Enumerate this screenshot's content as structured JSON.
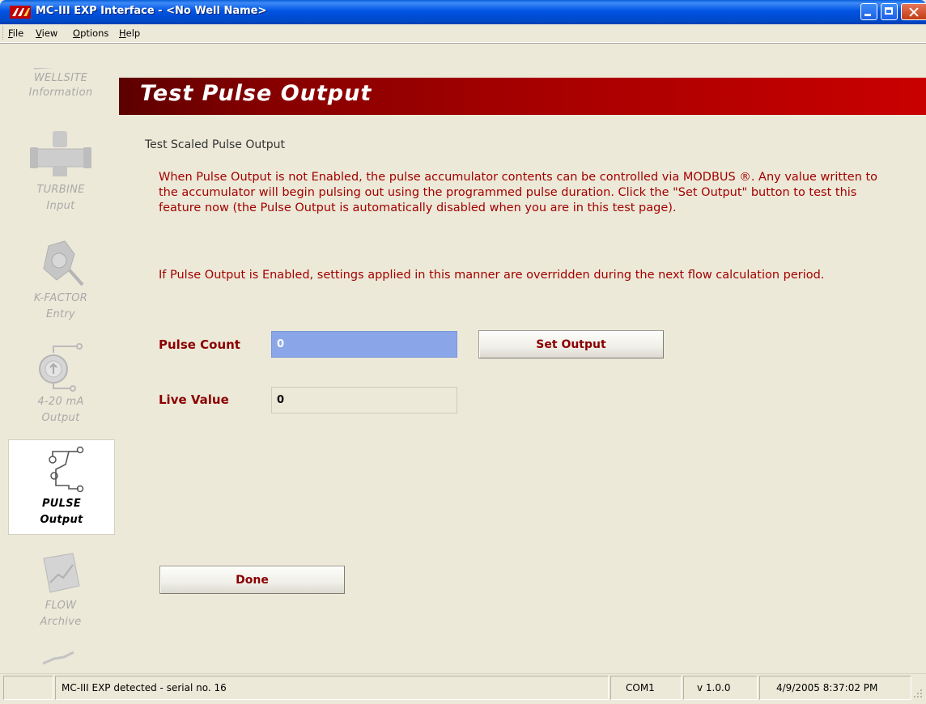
{
  "window": {
    "title": "MC-III EXP Interface - <No Well Name>",
    "titlebar_color": "#0054e3",
    "controls": [
      "minimize-icon",
      "maximize-icon",
      "close-icon"
    ]
  },
  "menu": {
    "items": [
      {
        "label": "File"
      },
      {
        "label": "View"
      },
      {
        "label": "Options"
      },
      {
        "label": "Help"
      }
    ]
  },
  "sidebar": {
    "items": [
      {
        "line1": "WELLSITE",
        "line2": "Information",
        "icon": "wellsite-icon",
        "active": false
      },
      {
        "line1": "TURBINE",
        "line2": "Input",
        "icon": "turbine-icon",
        "active": false
      },
      {
        "line1": "K-FACTOR",
        "line2": "Entry",
        "icon": "k-factor-icon",
        "active": false
      },
      {
        "line1": "4-20 mA",
        "line2": "Output",
        "icon": "gauge-icon",
        "active": false
      },
      {
        "line1": "PULSE",
        "line2": "Output",
        "icon": "pulse-icon",
        "active": true
      },
      {
        "line1": "FLOW",
        "line2": "Archive",
        "icon": "chart-icon",
        "active": false
      }
    ]
  },
  "header": {
    "title": "Test Pulse Output",
    "banner_color": "#a50000"
  },
  "main": {
    "section_title": "Test Scaled Pulse Output",
    "paragraph1": "When Pulse Output is not Enabled, the pulse accumulator contents can be controlled via MODBUS ®. Any value written to the accumulator will begin pulsing out using the programmed pulse duration. Click the \"Set Output\" button to test this feature now (the Pulse Output is automatically disabled when you are in this test page).",
    "paragraph2": "If Pulse Output is Enabled, settings applied in this manner are overridden during the next flow calculation period.",
    "text_color": "#a30000",
    "pulse_count": {
      "label": "Pulse Count",
      "value": "0"
    },
    "set_output_button": "Set Output",
    "live_value": {
      "label": "Live Value",
      "value": "0"
    },
    "done_button": "Done"
  },
  "statusbar": {
    "message": "MC-III EXP detected - serial no. 16",
    "port": "COM1",
    "version": "v 1.0.0",
    "datetime": "4/9/2005 8:37:02 PM"
  }
}
